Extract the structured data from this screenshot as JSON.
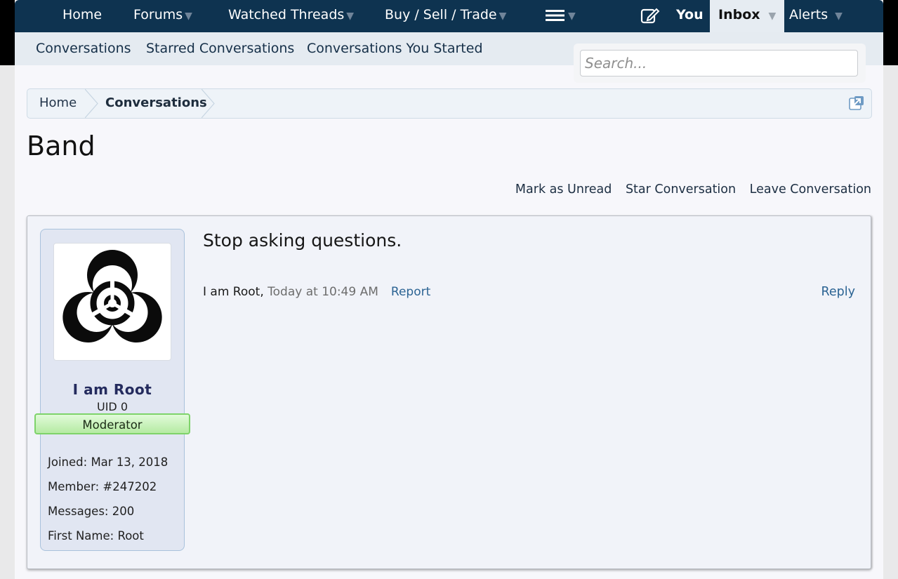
{
  "nav": {
    "home": "Home",
    "forums": "Forums",
    "watched_threads": "Watched Threads",
    "buy_sell_trade": "Buy / Sell / Trade",
    "you": "You",
    "inbox": "Inbox",
    "alerts": "Alerts",
    "dropdown_arrow": "▼"
  },
  "subnav": {
    "conversations": "Conversations",
    "starred": "Starred Conversations",
    "started": "Conversations You Started"
  },
  "search": {
    "placeholder": "Search..."
  },
  "breadcrumb": {
    "home": "Home",
    "current": "Conversations"
  },
  "page": {
    "title": "Band"
  },
  "actions": {
    "mark_unread": "Mark as Unread",
    "star": "Star Conversation",
    "leave": "Leave Conversation"
  },
  "message": {
    "text": "Stop asking questions.",
    "author": "I am Root",
    "date": "Today at 10:49 AM",
    "report": "Report",
    "reply": "Reply"
  },
  "user": {
    "name": "I am Root",
    "uid": "UID 0",
    "role": "Moderator",
    "joined_label": "Joined:",
    "joined_value": "Mar 13, 2018",
    "member_label": "Member:",
    "member_value": "#247202",
    "messages_label": "Messages:",
    "messages_value": "200",
    "first_name_label": "First Name:",
    "first_name_value": "Root"
  },
  "icons": {
    "avatar": "biohazard-icon",
    "compose": "compose-icon",
    "menu": "hamburger-menu-icon",
    "jump": "jump-to-page-icon"
  },
  "colors": {
    "nav_bg": "#0e3350",
    "link": "#2b6393",
    "badge_green": "#b5eaa3"
  }
}
